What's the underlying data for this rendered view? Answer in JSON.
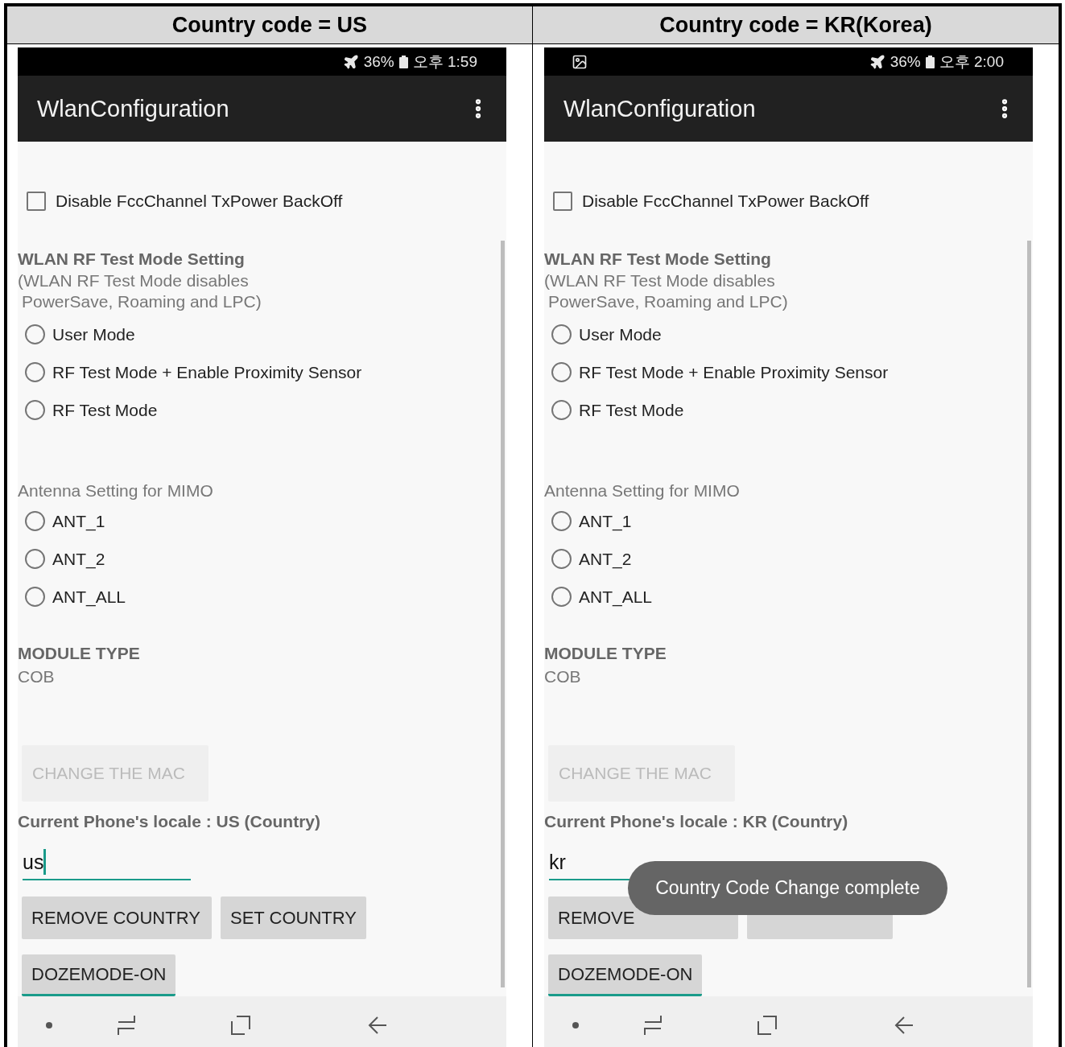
{
  "panels": [
    {
      "header": "Country code = US",
      "status": {
        "image_notification": false,
        "battery": "36%",
        "time": "오후 1:59"
      },
      "app_title": "WlanConfiguration",
      "checkbox": {
        "label": "Disable FccChannel TxPower BackOff",
        "checked": false
      },
      "rf": {
        "title": "WLAN RF Test Mode Setting",
        "note": [
          "(WLAN RF Test Mode disables",
          "PowerSave, Roaming and LPC)"
        ],
        "options": [
          {
            "label": "User Mode",
            "selected": false
          },
          {
            "label": "RF Test Mode + Enable Proximity Sensor",
            "selected": false
          },
          {
            "label": "RF Test Mode",
            "selected": false
          }
        ]
      },
      "antenna": {
        "title": "Antenna Setting for MIMO",
        "options": [
          {
            "label": "ANT_1",
            "selected": false
          },
          {
            "label": "ANT_2",
            "selected": false
          },
          {
            "label": "ANT_ALL",
            "selected": false
          }
        ]
      },
      "module": {
        "title": "MODULE TYPE",
        "value": "COB"
      },
      "change_mac": {
        "label": "CHANGE THE MAC",
        "disabled": true
      },
      "locale": "Current Phone's locale : US (Country)",
      "country_field": {
        "value": "us",
        "cursor": true
      },
      "buttons": [
        {
          "kind": "text",
          "label": "REMOVE COUNTRY"
        },
        {
          "kind": "text",
          "label": "SET COUNTRY"
        }
      ],
      "doze": {
        "label": "DOZEMODE-ON",
        "focused": true
      }
    },
    {
      "header": "Country code = KR(Korea)",
      "status": {
        "image_notification": true,
        "battery": "36%",
        "time": "오후 2:00"
      },
      "app_title": "WlanConfiguration",
      "checkbox": {
        "label": "Disable FccChannel TxPower BackOff",
        "checked": false
      },
      "rf": {
        "title": "WLAN RF Test Mode Setting",
        "note": [
          "(WLAN RF Test Mode disables",
          "PowerSave, Roaming and LPC)"
        ],
        "options": [
          {
            "label": "User Mode",
            "selected": false
          },
          {
            "label": "RF Test Mode + Enable Proximity Sensor",
            "selected": false
          },
          {
            "label": "RF Test Mode",
            "selected": false
          }
        ]
      },
      "antenna": {
        "title": "Antenna Setting for MIMO",
        "options": [
          {
            "label": "ANT_1",
            "selected": false
          },
          {
            "label": "ANT_2",
            "selected": false
          },
          {
            "label": "ANT_ALL",
            "selected": false
          }
        ]
      },
      "module": {
        "title": "MODULE TYPE",
        "value": "COB"
      },
      "change_mac": {
        "label": "CHANGE THE MAC",
        "disabled": true
      },
      "locale": "Current Phone's locale : KR (Country)",
      "country_field": {
        "value": "kr",
        "cursor": false
      },
      "buttons": [
        {
          "kind": "text",
          "label": "REMOVE"
        },
        {
          "kind": "covered"
        }
      ],
      "doze": {
        "label": "DOZEMODE-ON",
        "focused": true
      },
      "toast": "Country Code Change complete"
    }
  ]
}
